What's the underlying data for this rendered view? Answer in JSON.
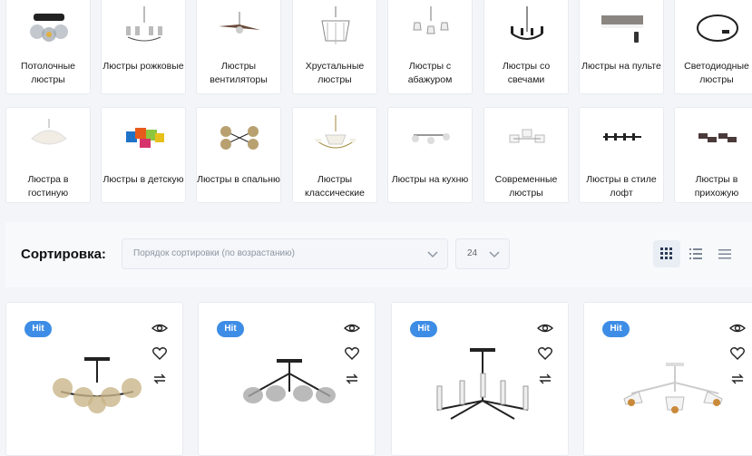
{
  "categories_row1": [
    {
      "label": "Потолочные люстры",
      "icon": "ceiling-chandelier-icon"
    },
    {
      "label": "Люстры рожковые",
      "icon": "arm-chandelier-icon"
    },
    {
      "label": "Люстры вентиляторы",
      "icon": "fan-chandelier-icon"
    },
    {
      "label": "Хрустальные люстры",
      "icon": "crystal-chandelier-icon"
    },
    {
      "label": "Люстры с абажуром",
      "icon": "shade-chandelier-icon"
    },
    {
      "label": "Люстры со свечами",
      "icon": "candle-chandelier-icon"
    },
    {
      "label": "Люстры на пульте",
      "icon": "remote-chandelier-icon"
    },
    {
      "label": "Светодиодные люстры",
      "icon": "led-ring-icon"
    }
  ],
  "categories_row2": [
    {
      "label": "Люстра в гостиную",
      "icon": "living-room-chandelier-icon"
    },
    {
      "label": "Люстры в детскую",
      "icon": "kids-chandelier-icon"
    },
    {
      "label": "Люстры в спальню",
      "icon": "bedroom-chandelier-icon"
    },
    {
      "label": "Люстры классические",
      "icon": "classic-chandelier-icon"
    },
    {
      "label": "Люстры на кухню",
      "icon": "kitchen-chandelier-icon"
    },
    {
      "label": "Современные люстры",
      "icon": "modern-chandelier-icon"
    },
    {
      "label": "Люстры в стиле лофт",
      "icon": "loft-chandelier-icon"
    },
    {
      "label": "Люстры в прихожую",
      "icon": "hallway-chandelier-icon"
    }
  ],
  "sort": {
    "title": "Сортировка:",
    "order_placeholder": "Порядок сортировки (по возрастанию)",
    "per_page": "24"
  },
  "view_modes": [
    "grid-view-icon",
    "list-view-icon",
    "compact-list-icon"
  ],
  "products": [
    {
      "badge": "Hit"
    },
    {
      "badge": "Hit"
    },
    {
      "badge": "Hit"
    },
    {
      "badge": "Hit"
    }
  ],
  "colors": {
    "accent": "#3d8de6",
    "text": "#111111",
    "muted": "#8e97a3"
  }
}
